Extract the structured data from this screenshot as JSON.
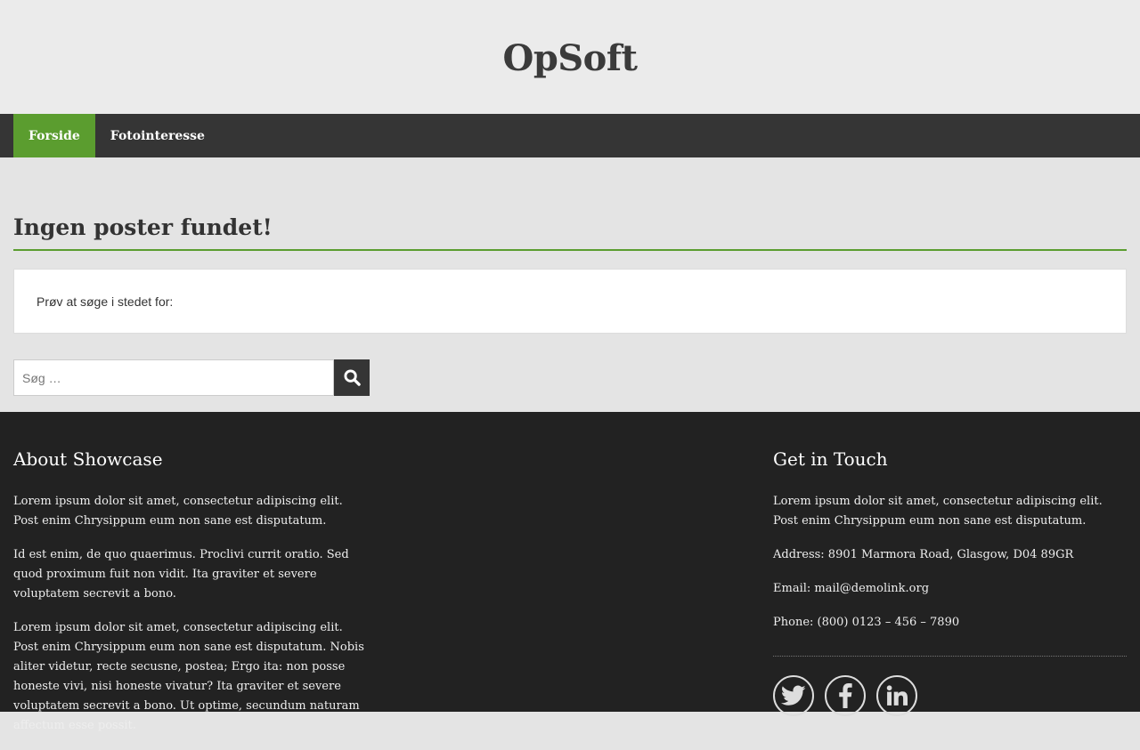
{
  "header": {
    "site_title": "OpSoft"
  },
  "nav": {
    "items": [
      {
        "label": "Forside"
      },
      {
        "label": "Fotointeresse"
      }
    ]
  },
  "main": {
    "title": "Ingen poster fundet!",
    "notice": "Prøv at søge i stedet for:",
    "search": {
      "placeholder": "Søg …",
      "value": ""
    }
  },
  "footer": {
    "about": {
      "heading": "About Showcase",
      "paragraphs": [
        "Lorem ipsum dolor sit amet, consectetur adipiscing elit. Post enim Chrysippum eum non sane est disputatum.",
        "Id est enim, de quo quaerimus. Proclivi currit oratio. Sed quod proximum fuit non vidit. Ita graviter et severe voluptatem secrevit a bono.",
        "Lorem ipsum dolor sit amet, consectetur adipiscing elit. Post enim Chrysippum eum non sane est disputatum. Nobis aliter videtur, recte secusne, postea; Ergo ita: non posse honeste vivi, nisi honeste vivatur? Ita graviter et severe voluptatem secrevit a bono. Ut optime, secundum naturam affectum esse possit."
      ]
    },
    "contact": {
      "heading": "Get in Touch",
      "intro": "Lorem ipsum dolor sit amet, consectetur adipiscing elit. Post enim Chrysippum eum non sane est disputatum.",
      "address": "Address: 8901 Marmora Road, Glasgow, D04 89GR",
      "email": "Email: mail@demolink.org",
      "phone": "Phone: (800) 0123 – 456 – 7890"
    },
    "social": [
      {
        "icon": "twitter-icon"
      },
      {
        "icon": "facebook-icon"
      },
      {
        "icon": "linkedin-icon"
      }
    ]
  },
  "colors": {
    "accent": "#5b9d2f",
    "nav_bg": "#353535",
    "footer_bg": "#222222",
    "header_bg": "#ebebeb"
  }
}
